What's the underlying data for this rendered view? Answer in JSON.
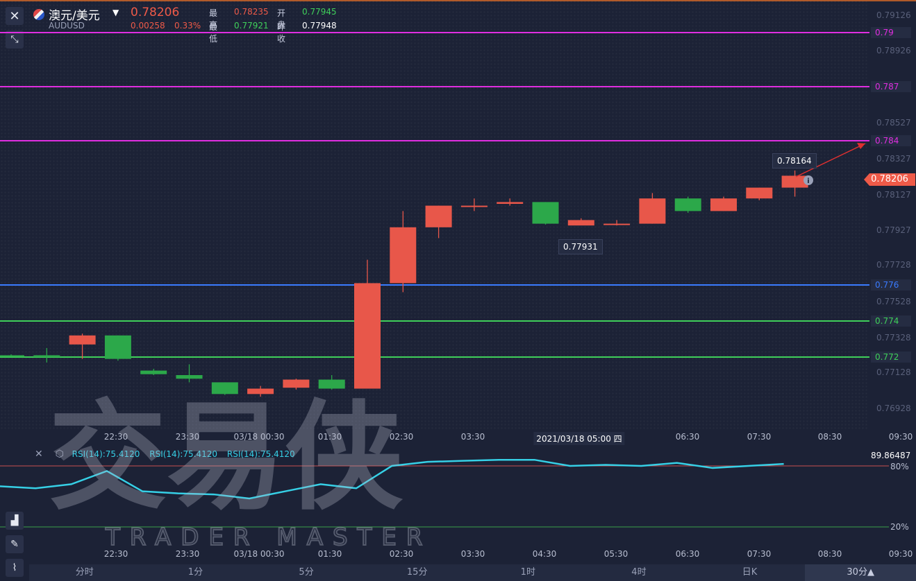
{
  "header": {
    "symbol": "澳元/美元",
    "code": "AUDUSD",
    "price": "0.78206",
    "change": "0.00258",
    "change_pct": "0.33%",
    "high_label": "最高",
    "high_value": "0.78235",
    "open_label": "开盘",
    "open_value": "0.77945",
    "low_label": "最低",
    "low_value": "0.77921",
    "prev_close_label": "昨收",
    "prev_close_value": "0.77948"
  },
  "levels": [
    {
      "value": "0.79",
      "color": "#e02ee0"
    },
    {
      "value": "0.787",
      "color": "#e02ee0"
    },
    {
      "value": "0.784",
      "color": "#e02ee0"
    },
    {
      "value": "0.776",
      "color": "#3a7bff"
    },
    {
      "value": "0.774",
      "color": "#3fd05a"
    },
    {
      "value": "0.772",
      "color": "#3fd05a"
    }
  ],
  "current_price_tag": "0.78206",
  "price_axis": [
    "0.79126",
    "0.78926",
    "0.78726",
    "0.78527",
    "0.78327",
    "0.78127",
    "0.77927",
    "0.77728",
    "0.77528",
    "0.77328",
    "0.77128",
    "0.76928"
  ],
  "annotations": {
    "high_marker": "0.78164",
    "low_marker": "0.77931"
  },
  "chart_data": {
    "type": "candlestick",
    "candles": [
      {
        "o": 0.7721,
        "h": 0.77215,
        "l": 0.77205,
        "c": 0.77205
      },
      {
        "o": 0.7721,
        "h": 0.7725,
        "l": 0.7717,
        "c": 0.772
      },
      {
        "o": 0.7727,
        "h": 0.7733,
        "l": 0.7719,
        "c": 0.7732
      },
      {
        "o": 0.7732,
        "h": 0.7732,
        "l": 0.7718,
        "c": 0.7719
      },
      {
        "o": 0.77125,
        "h": 0.77135,
        "l": 0.771,
        "c": 0.77105
      },
      {
        "o": 0.771,
        "h": 0.7716,
        "l": 0.7706,
        "c": 0.7708
      },
      {
        "o": 0.7706,
        "h": 0.7706,
        "l": 0.7699,
        "c": 0.76995
      },
      {
        "o": 0.76995,
        "h": 0.7704,
        "l": 0.7698,
        "c": 0.77025
      },
      {
        "o": 0.7703,
        "h": 0.7708,
        "l": 0.7702,
        "c": 0.77075
      },
      {
        "o": 0.77075,
        "h": 0.771,
        "l": 0.7702,
        "c": 0.77025
      },
      {
        "o": 0.77025,
        "h": 0.7774,
        "l": 0.77025,
        "c": 0.7761
      },
      {
        "o": 0.7761,
        "h": 0.7801,
        "l": 0.7756,
        "c": 0.7792
      },
      {
        "o": 0.7792,
        "h": 0.7804,
        "l": 0.7786,
        "c": 0.7804
      },
      {
        "o": 0.7804,
        "h": 0.7808,
        "l": 0.7801,
        "c": 0.7804
      },
      {
        "o": 0.7805,
        "h": 0.7808,
        "l": 0.7804,
        "c": 0.7806
      },
      {
        "o": 0.7806,
        "h": 0.7806,
        "l": 0.77935,
        "c": 0.7794
      },
      {
        "o": 0.7793,
        "h": 0.7797,
        "l": 0.77931,
        "c": 0.7796
      },
      {
        "o": 0.7794,
        "h": 0.7796,
        "l": 0.7793,
        "c": 0.7794
      },
      {
        "o": 0.7794,
        "h": 0.7811,
        "l": 0.7794,
        "c": 0.7808
      },
      {
        "o": 0.7808,
        "h": 0.7809,
        "l": 0.78,
        "c": 0.7801
      },
      {
        "o": 0.7801,
        "h": 0.7809,
        "l": 0.7801,
        "c": 0.7808
      },
      {
        "o": 0.7808,
        "h": 0.7814,
        "l": 0.7807,
        "c": 0.7814
      },
      {
        "o": 0.7814,
        "h": 0.78235,
        "l": 0.7809,
        "c": 0.78206
      }
    ],
    "rsi": [
      60,
      58,
      62,
      75,
      55,
      53,
      52,
      48,
      55,
      62,
      58,
      80,
      84,
      85,
      86,
      86,
      80,
      81,
      80,
      83,
      78,
      80,
      82
    ],
    "rsi_levels": [
      80,
      20
    ]
  },
  "time_axis_top": [
    "22:30",
    "23:30",
    "03/18 00:30",
    "01:30",
    "02:30",
    "03:30",
    "2021/03/18 05:00 四",
    "06:30",
    "07:30",
    "08:30",
    "09:30"
  ],
  "rsi": {
    "labels": [
      "RSI(14):75.4120",
      "RSI(14):75.4120",
      "RSI(14):75.4120"
    ],
    "value": "89.86487",
    "level_high": "80%",
    "level_low": "20%"
  },
  "time_axis_bottom": [
    "22:30",
    "23:30",
    "03/18 00:30",
    "01:30",
    "02:30",
    "03:30",
    "04:30",
    "05:30",
    "06:30",
    "07:30",
    "08:30",
    "09:30"
  ],
  "timeframes": [
    "分时",
    "1分",
    "5分",
    "15分",
    "1时",
    "4时",
    "日K",
    "30分▲"
  ],
  "watermark": {
    "cn": "交易侠",
    "en": "TRADER MASTER"
  }
}
